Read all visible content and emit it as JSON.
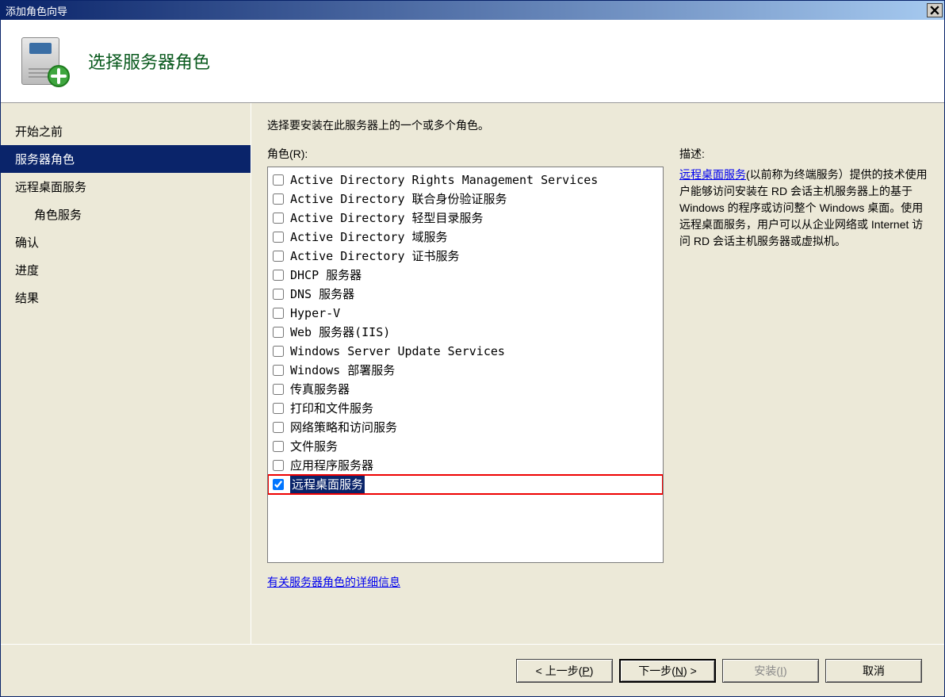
{
  "titlebar": {
    "title": "添加角色向导"
  },
  "header": {
    "title": "选择服务器角色"
  },
  "sidebar": {
    "items": [
      {
        "label": "开始之前",
        "active": false,
        "indent": false
      },
      {
        "label": "服务器角色",
        "active": true,
        "indent": false
      },
      {
        "label": "远程桌面服务",
        "active": false,
        "indent": false
      },
      {
        "label": "角色服务",
        "active": false,
        "indent": true
      },
      {
        "label": "确认",
        "active": false,
        "indent": false
      },
      {
        "label": "进度",
        "active": false,
        "indent": false
      },
      {
        "label": "结果",
        "active": false,
        "indent": false
      }
    ]
  },
  "main": {
    "instruction": "选择要安装在此服务器上的一个或多个角色。",
    "roles_label": "角色(R):",
    "desc_label": "描述:",
    "desc_link": "远程桌面服务",
    "desc_tail": "(以前称为终端服务）提供的技术使用户能够访问安装在 RD 会话主机服务器上的基于 Windows 的程序或访问整个 Windows 桌面。使用远程桌面服务，用户可以从企业网络或 Internet 访问 RD 会话主机服务器或虚拟机。",
    "more_link": "有关服务器角色的详细信息",
    "roles": [
      {
        "label": "Active Directory Rights Management Services",
        "checked": false,
        "selected": false,
        "highlighted": false
      },
      {
        "label": "Active Directory 联合身份验证服务",
        "checked": false,
        "selected": false,
        "highlighted": false
      },
      {
        "label": "Active Directory 轻型目录服务",
        "checked": false,
        "selected": false,
        "highlighted": false
      },
      {
        "label": "Active Directory 域服务",
        "checked": false,
        "selected": false,
        "highlighted": false
      },
      {
        "label": "Active Directory 证书服务",
        "checked": false,
        "selected": false,
        "highlighted": false
      },
      {
        "label": "DHCP 服务器",
        "checked": false,
        "selected": false,
        "highlighted": false
      },
      {
        "label": "DNS 服务器",
        "checked": false,
        "selected": false,
        "highlighted": false
      },
      {
        "label": "Hyper-V",
        "checked": false,
        "selected": false,
        "highlighted": false
      },
      {
        "label": "Web 服务器(IIS)",
        "checked": false,
        "selected": false,
        "highlighted": false
      },
      {
        "label": "Windows Server Update Services",
        "checked": false,
        "selected": false,
        "highlighted": false
      },
      {
        "label": "Windows 部署服务",
        "checked": false,
        "selected": false,
        "highlighted": false
      },
      {
        "label": "传真服务器",
        "checked": false,
        "selected": false,
        "highlighted": false
      },
      {
        "label": "打印和文件服务",
        "checked": false,
        "selected": false,
        "highlighted": false
      },
      {
        "label": "网络策略和访问服务",
        "checked": false,
        "selected": false,
        "highlighted": false
      },
      {
        "label": "文件服务",
        "checked": false,
        "selected": false,
        "highlighted": false
      },
      {
        "label": "应用程序服务器",
        "checked": false,
        "selected": false,
        "highlighted": false
      },
      {
        "label": "远程桌面服务",
        "checked": true,
        "selected": true,
        "highlighted": true
      }
    ]
  },
  "footer": {
    "prev_prefix": "< 上一步(",
    "prev_accel": "P",
    "prev_suffix": ")",
    "next_prefix": "下一步(",
    "next_accel": "N",
    "next_suffix": ") >",
    "install_prefix": "安装(",
    "install_accel": "I",
    "install_suffix": ")",
    "cancel": "取消"
  }
}
